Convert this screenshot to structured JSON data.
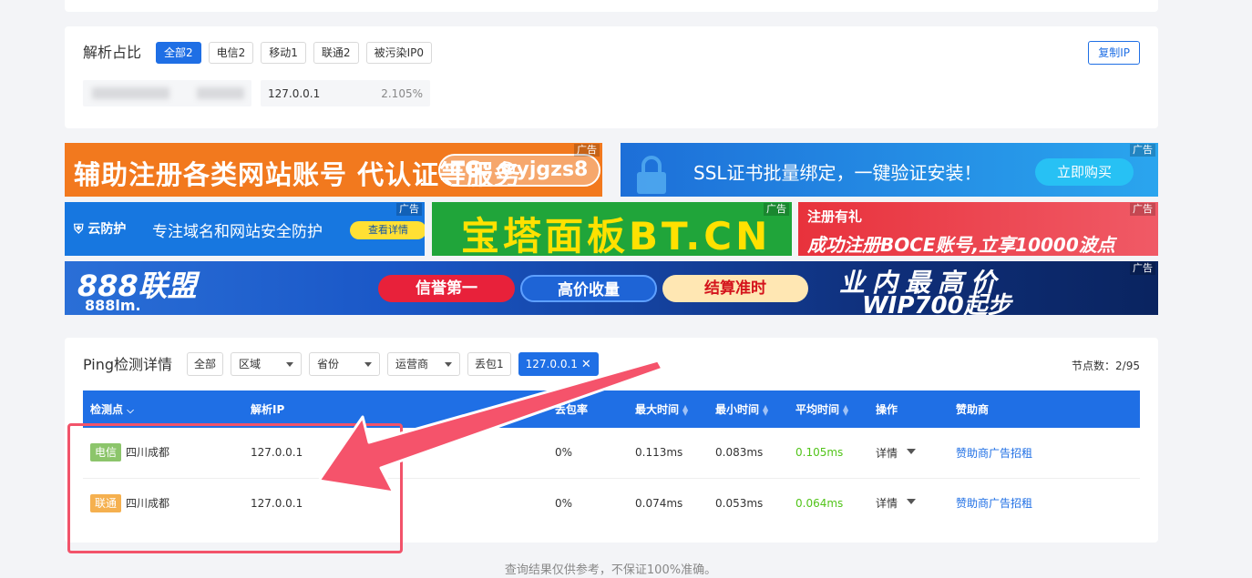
{
  "ratio_card": {
    "title": "解析占比",
    "chips": [
      "全部2",
      "电信2",
      "移动1",
      "联通2",
      "被污染IP0"
    ],
    "copy_label": "复制IP",
    "entry": {
      "ip": "127.0.0.1",
      "percent": "2.105%"
    }
  },
  "ads": {
    "tag": "广告",
    "ad1": {
      "text": "辅助注册各类网站账号 代认证等服务",
      "tg": "TG: @yjgzs8"
    },
    "ad2": {
      "text": "SSL证书批量绑定，一键验证安装！",
      "button": "立即购买"
    },
    "ad3": {
      "logo": "云防护",
      "text": "专注域名和网站安全防护",
      "button": "查看详情"
    },
    "ad4": {
      "text": "宝塔面板BT.CN"
    },
    "ad5": {
      "line1": "注册有礼",
      "line2": "成功注册BOCE账号,立享10000波点"
    },
    "ad6": {
      "logo": "888联盟",
      "sub": "888lm.",
      "pill1": "信誉第一",
      "pill2": "高价收量",
      "pill3": "结算准时",
      "right1": "业内最高价",
      "right2": "WIP700起步"
    }
  },
  "ping_card": {
    "title": "Ping检测详情",
    "filters": {
      "all": "全部",
      "region": "区域",
      "province": "省份",
      "isp": "运营商",
      "loss": "丢包1",
      "active_ip": "127.0.0.1"
    },
    "node_count": "节点数：2/95",
    "columns": [
      "检测点",
      "解析IP",
      "丢包率",
      "最大时间",
      "最小时间",
      "平均时间",
      "操作",
      "赞助商"
    ],
    "rows": [
      {
        "isp": "电信",
        "location": "四川成都",
        "ip": "127.0.0.1",
        "loss": "0%",
        "max": "0.113ms",
        "min": "0.083ms",
        "avg": "0.105ms",
        "action": "详情",
        "sponsor": "赞助商广告招租"
      },
      {
        "isp": "联通",
        "location": "四川成都",
        "ip": "127.0.0.1",
        "loss": "0%",
        "max": "0.074ms",
        "min": "0.053ms",
        "avg": "0.064ms",
        "action": "详情",
        "sponsor": "赞助商广告招租"
      }
    ]
  },
  "footer_note": "查询结果仅供参考，不保证100%准确。",
  "colors": {
    "primary": "#1f6fe5",
    "highlight": "#f2536a",
    "telecom": "#8cc56b",
    "unicom": "#f5b04f",
    "avg_green": "#52c41a"
  }
}
